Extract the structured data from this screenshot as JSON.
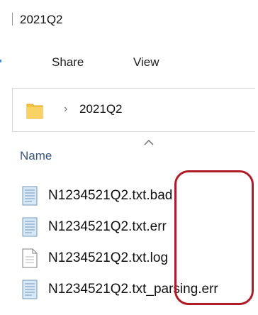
{
  "window": {
    "title": "2021Q2"
  },
  "ribbon": {
    "tabs": [
      {
        "label": "Share"
      },
      {
        "label": "View"
      }
    ]
  },
  "address_bar": {
    "separator": "›",
    "current": "2021Q2"
  },
  "column_header": {
    "name": "Name",
    "sort": "ascending",
    "sort_icon": "chevron-up-icon"
  },
  "files": [
    {
      "name": "N1234521Q2.txt.bad",
      "icon": "text-document-icon"
    },
    {
      "name": "N1234521Q2.txt.err",
      "icon": "text-document-icon"
    },
    {
      "name": "N1234521Q2.txt.log",
      "icon": "blank-document-icon"
    },
    {
      "name": "N1234521Q2.txt_parsing.err",
      "icon": "text-document-icon"
    }
  ],
  "colors": {
    "annotation": "#b01a26",
    "folder": "#f5c542",
    "header_text": "#3a5678",
    "accent": "#3b8ed8"
  },
  "annotation_shape": "rounded-rectangle"
}
